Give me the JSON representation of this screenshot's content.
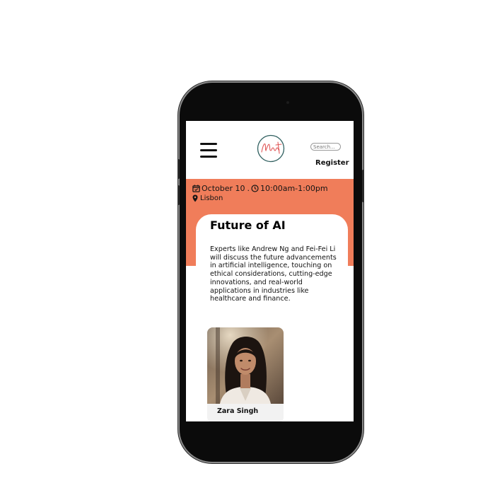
{
  "header": {
    "logo_text": "Meet",
    "search_placeholder": "Search...",
    "register_label": "Register"
  },
  "event": {
    "date": "October 10",
    "time": "10:00am-1:00pm",
    "location": "Lisbon",
    "title": "Future of AI",
    "description": "Experts like Andrew Ng and Fei-Fei Li will discuss the future advancements in artificial intelligence, touching on ethical considerations, cutting-edge innovations, and real-world applications in industries like healthcare and finance."
  },
  "speakers": [
    {
      "name": "Zara Singh"
    }
  ],
  "colors": {
    "accent": "#f07d5a",
    "phone_frame": "#0b0b0b",
    "logo_accent": "#e05a5a",
    "logo_ring": "#2f5f5f"
  },
  "icons": {
    "menu": "hamburger-menu-icon",
    "calendar": "calendar-check-icon",
    "clock": "clock-icon",
    "location": "map-pin-icon"
  }
}
